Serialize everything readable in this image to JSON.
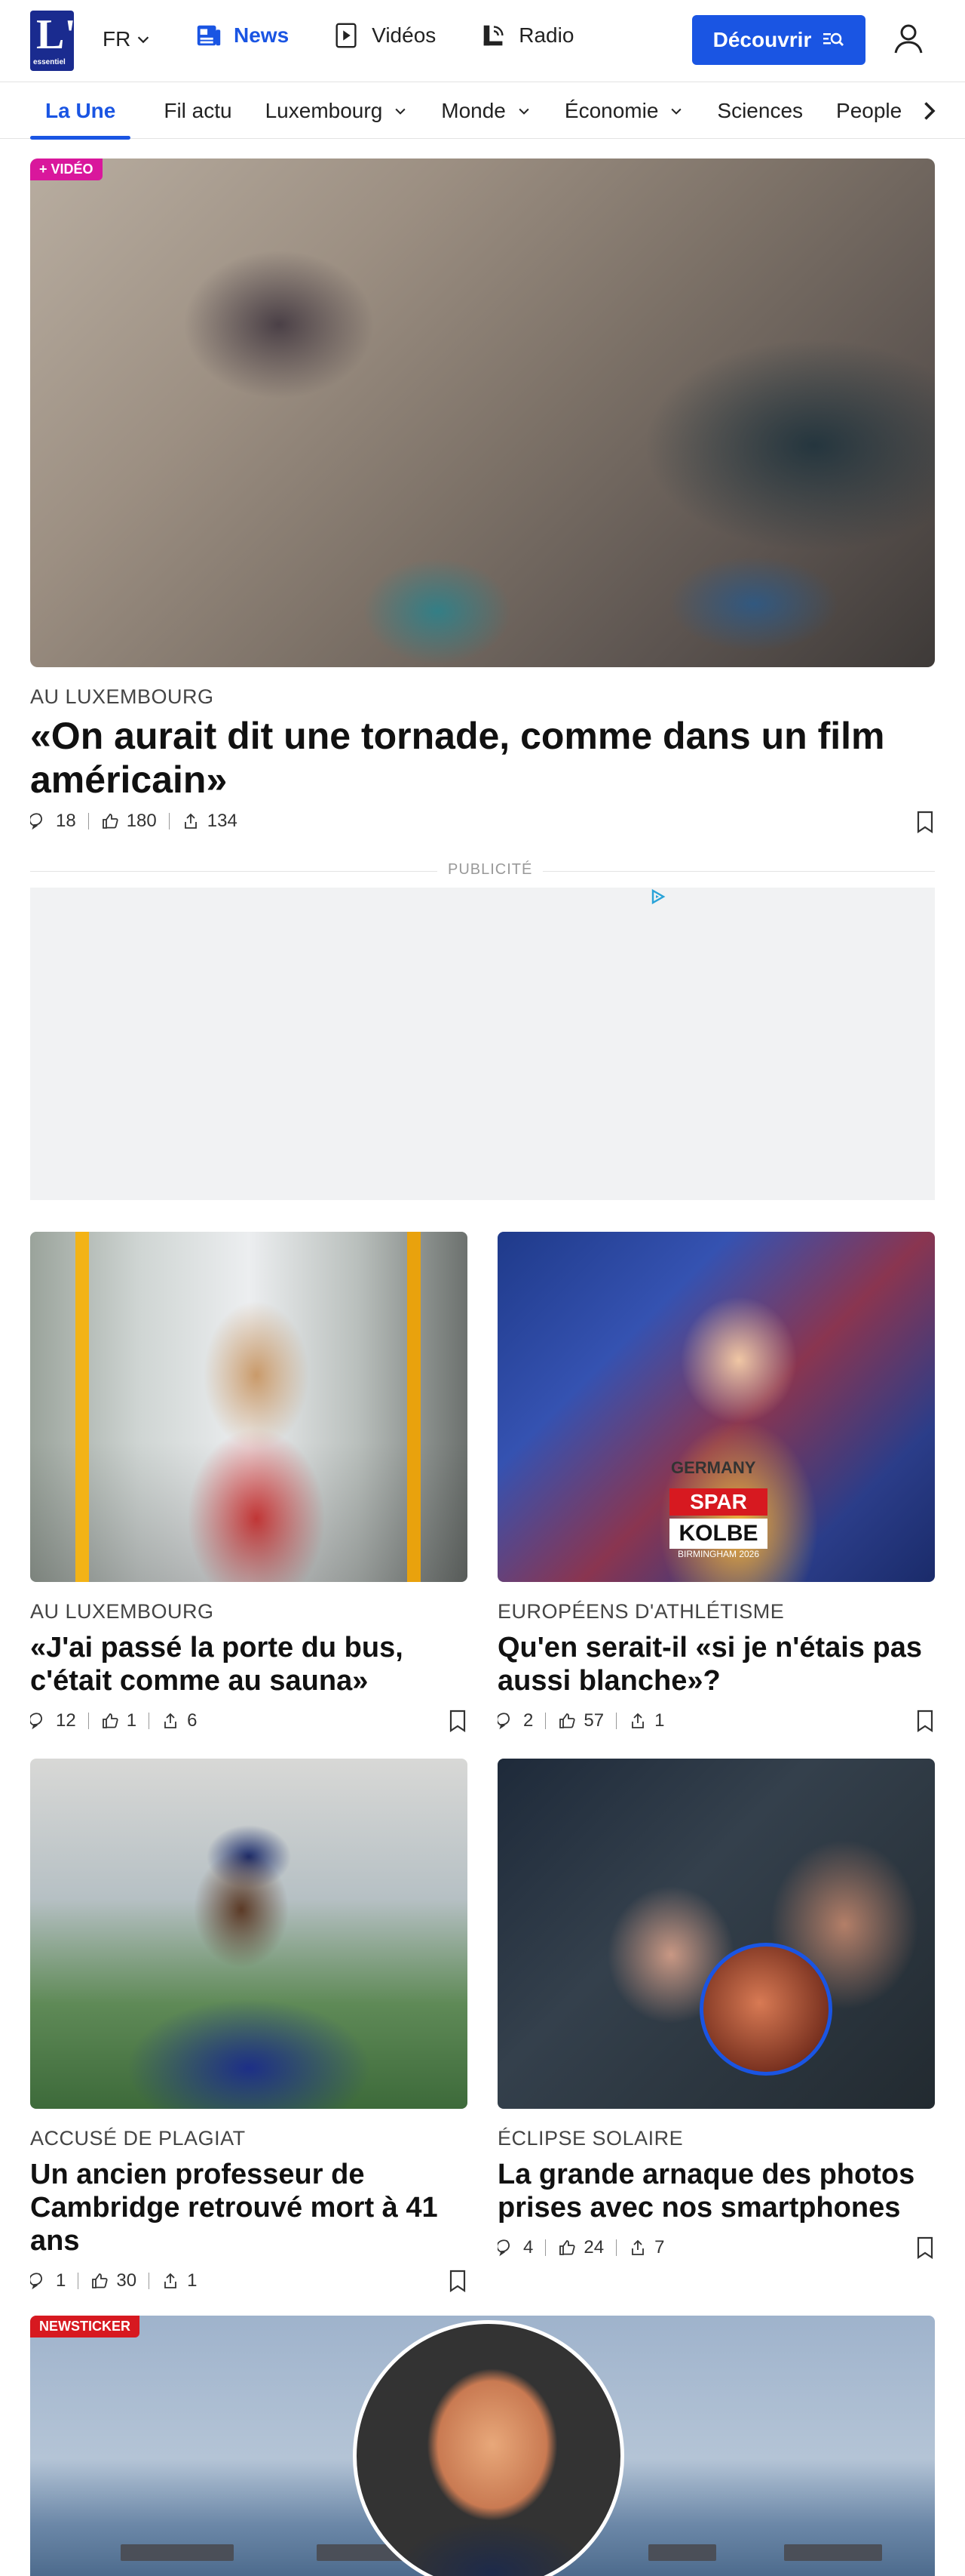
{
  "header": {
    "logo_big": "L'",
    "logo_small": "essentiel",
    "lang": "FR",
    "nav": [
      {
        "label": "News",
        "icon": "news-icon",
        "active": true
      },
      {
        "label": "Vidéos",
        "icon": "video-icon",
        "active": false
      },
      {
        "label": "Radio",
        "icon": "radio-icon",
        "active": false
      }
    ],
    "discover_label": "Découvrir"
  },
  "sections": {
    "items": [
      "La Une",
      "Fil actu",
      "Luxembourg",
      "Monde",
      "Économie",
      "Sciences",
      "People"
    ]
  },
  "hero": {
    "badge": "+ VIDÉO",
    "kicker": "AU LUXEMBOURG",
    "title": "«On aurait dit une tornade, comme dans un film américain»",
    "comments": "18",
    "likes": "180",
    "shares": "134"
  },
  "pub": {
    "label": "PUBLICITÉ"
  },
  "cards": [
    {
      "kicker": "AU LUXEMBOURG",
      "title": "«J'ai passé la porte du bus, c'était comme au sauna»",
      "comments": "12",
      "likes": "1",
      "shares": "6"
    },
    {
      "kicker": "EUROPÉENS D'ATHLÉTISME",
      "title": "Qu'en serait-il «si je n'étais pas aussi blanche»?",
      "comments": "2",
      "likes": "57",
      "shares": "1",
      "image_text": [
        "GERMANY",
        "SPAR",
        "KOLBE",
        "BIRMINGHAM 2026"
      ]
    },
    {
      "kicker": "ACCUSÉ DE PLAGIAT",
      "title": "Un ancien professeur de Cambridge retrouvé mort à 41 ans",
      "comments": "1",
      "likes": "30",
      "shares": "1"
    },
    {
      "kicker": "ÉCLIPSE SOLAIRE",
      "title": "La grande arnaque des photos prises avec nos smartphones",
      "comments": "4",
      "likes": "24",
      "shares": "7"
    }
  ],
  "newsticker": {
    "badge": "NEWSTICKER"
  },
  "colors": {
    "accent": "#1a55e3",
    "logo": "#1a2b8f",
    "video_badge": "#d9179c",
    "news_badge": "#d71920"
  }
}
